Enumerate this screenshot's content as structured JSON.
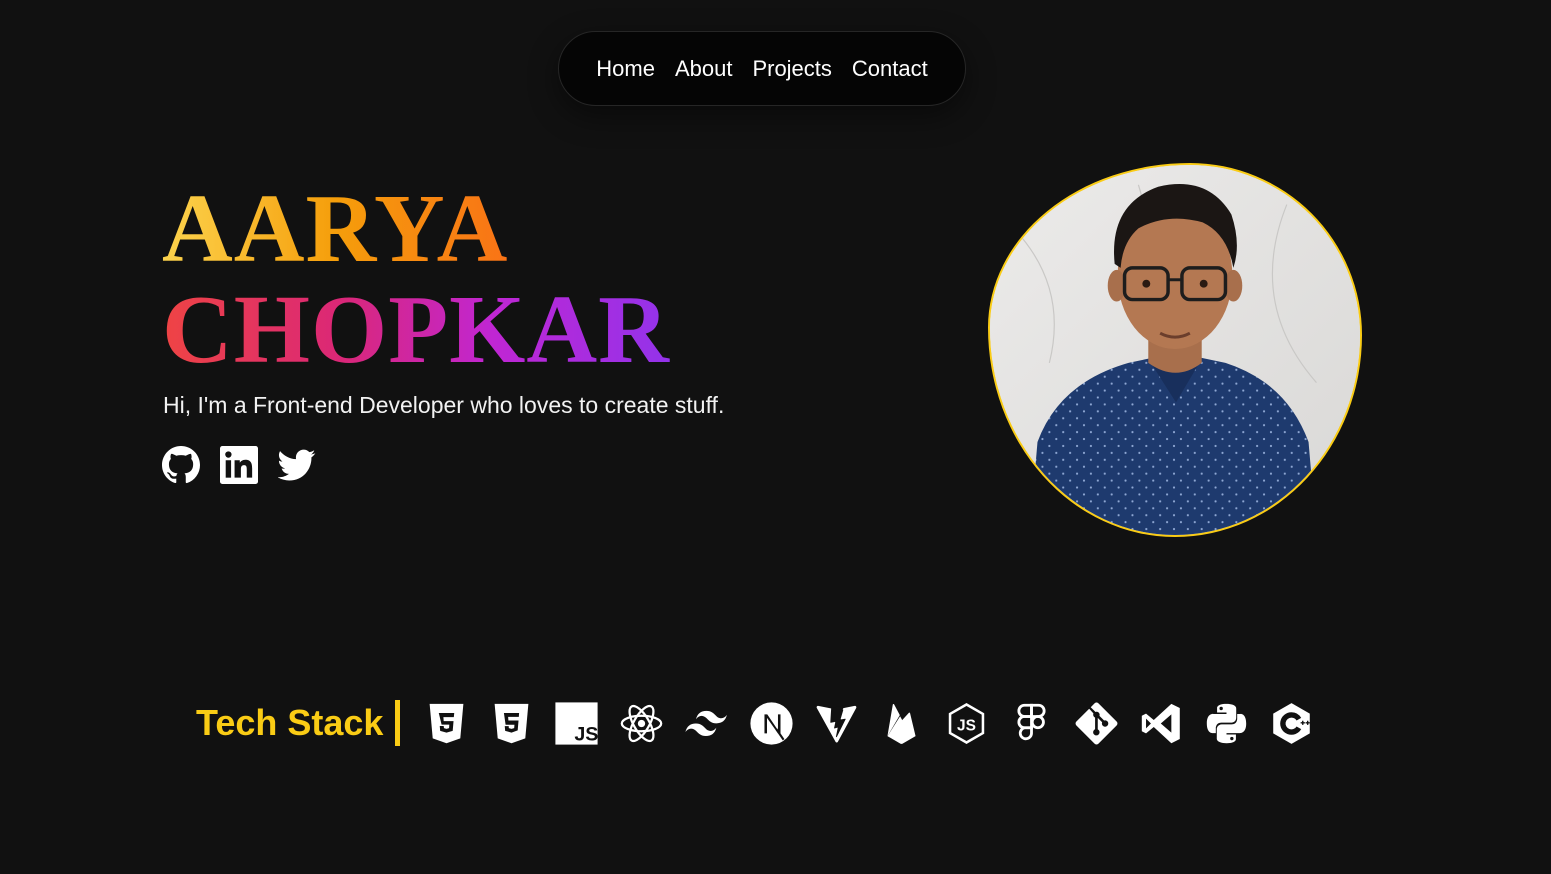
{
  "nav": {
    "items": [
      "Home",
      "About",
      "Projects",
      "Contact"
    ]
  },
  "hero": {
    "first_name": "AARYA",
    "last_name": "CHOPKAR",
    "tagline": "Hi, I'm a Front-end Developer who loves to create stuff.",
    "socials": [
      "github-icon",
      "linkedin-icon",
      "twitter-icon"
    ]
  },
  "avatar": {
    "border_color": "#facc15"
  },
  "tech_stack": {
    "title": "Tech Stack",
    "icons": [
      "html5-icon",
      "css3-icon",
      "javascript-icon",
      "react-icon",
      "tailwind-icon",
      "nextjs-icon",
      "vite-icon",
      "firebase-icon",
      "nodejs-icon",
      "figma-icon",
      "git-icon",
      "vscode-icon",
      "python-icon",
      "cplusplus-icon"
    ]
  },
  "colors": {
    "background": "#111111",
    "accent": "#facc15",
    "name_gradient_1": [
      "#fcd34d",
      "#f97316"
    ],
    "name_gradient_2": [
      "#ef4444",
      "#9333ea"
    ]
  }
}
